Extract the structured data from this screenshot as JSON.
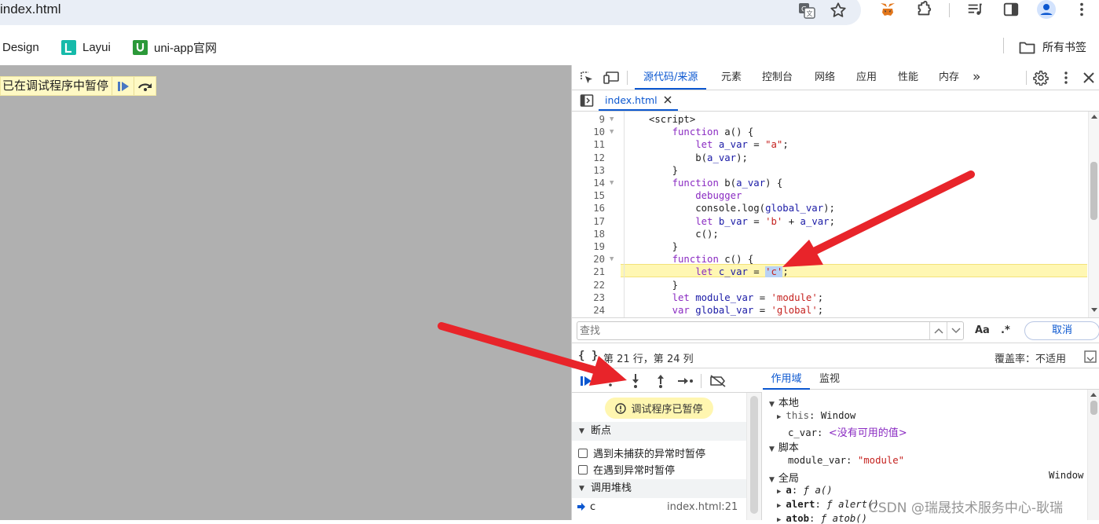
{
  "browser": {
    "url_text": "index.html",
    "bookmarks": [
      {
        "label": "Design"
      },
      {
        "label": "Layui",
        "icon_color": "#16baaa"
      },
      {
        "label": "uni-app官网",
        "icon_color": "#2b9939"
      }
    ],
    "all_bookmarks_label": "所有书签"
  },
  "page": {
    "paused_label": "已在调试程序中暂停"
  },
  "devtools": {
    "tabs": [
      "源代码/来源",
      "元素",
      "控制台",
      "网络",
      "应用",
      "性能",
      "内存"
    ],
    "active_tab": "源代码/来源",
    "more_tabs": "»",
    "file_tab": "index.html",
    "code_lines": [
      {
        "n": "9",
        "text": "<script>",
        "fold": true
      },
      {
        "n": "10",
        "text": "    function a() {",
        "fold": true
      },
      {
        "n": "11",
        "text": "        let a_var = \"a\";"
      },
      {
        "n": "12",
        "text": "        b(a_var);"
      },
      {
        "n": "13",
        "text": "    }"
      },
      {
        "n": "14",
        "text": "    function b(a_var) {",
        "fold": true
      },
      {
        "n": "15",
        "text": "        debugger"
      },
      {
        "n": "16",
        "text": "        console.log(global_var);"
      },
      {
        "n": "17",
        "text": "        let b_var = 'b' + a_var;"
      },
      {
        "n": "18",
        "text": "        c();"
      },
      {
        "n": "19",
        "text": "    }"
      },
      {
        "n": "20",
        "text": "    function c() {",
        "fold": true
      },
      {
        "n": "21",
        "text": "        let c_var = 'c';",
        "highlight": true
      },
      {
        "n": "22",
        "text": "    }"
      },
      {
        "n": "23",
        "text": "    let module_var = 'module';"
      },
      {
        "n": "24",
        "text": "    var global_var = 'global';"
      }
    ],
    "search": {
      "placeholder": "查找",
      "match_case": "Aa",
      "regex": ".*",
      "cancel": "取消"
    },
    "status": {
      "position": "第 21 行，第 24 列",
      "coverage": "覆盖率：不适用"
    },
    "paused_badge": "调试程序已暂停",
    "sections": {
      "breakpoints": "断点",
      "pause_uncaught": "遇到未捕获的异常时暂停",
      "pause_caught": "在遇到异常时暂停",
      "call_stack": "调用堆栈"
    },
    "call_stack": [
      {
        "name": "c",
        "location": "index.html:21"
      }
    ],
    "scope_tabs": [
      "作用域",
      "监视"
    ],
    "scope": {
      "local": "本地",
      "this_key": "this",
      "this_val": "Window",
      "c_var_key": "c_var",
      "c_var_val": "<没有可用的值>",
      "script": "脚本",
      "module_var_key": "module_var",
      "module_var_val": "\"module\"",
      "global": "全局",
      "global_val": "Window",
      "a_key": "a",
      "a_val": "ƒ a()",
      "alert_key": "alert",
      "alert_val": "ƒ alert()",
      "atob_key": "atob",
      "atob_val": "ƒ atob()"
    }
  },
  "watermark": "CSDN @瑞晟技术服务中心-耿瑞",
  "colors": {
    "accent": "#0b57d0",
    "arrow": "#e8242a",
    "highlight_line": "#fff7b3"
  }
}
